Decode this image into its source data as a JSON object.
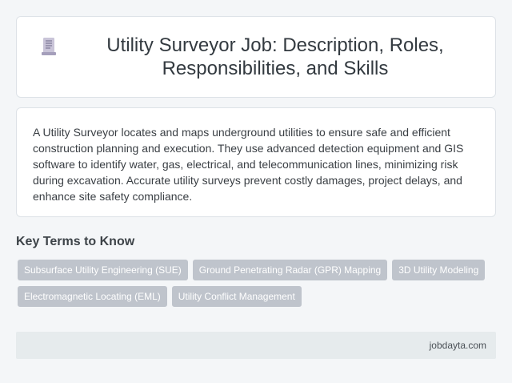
{
  "header": {
    "icon": "document-icon",
    "title": "Utility Surveyor Job: Description, Roles, Responsibilities, and Skills"
  },
  "description": "A Utility Surveyor locates and maps underground utilities to ensure safe and efficient construction planning and execution. They use advanced detection equipment and GIS software to identify water, gas, electrical, and telecommunication lines, minimizing risk during excavation. Accurate utility surveys prevent costly damages, project delays, and enhance site safety compliance.",
  "key_terms": {
    "heading": "Key Terms to Know",
    "tags": [
      "Subsurface Utility Engineering (SUE)",
      "Ground Penetrating Radar (GPR) Mapping",
      "3D Utility Modeling",
      "Electromagnetic Locating (EML)",
      "Utility Conflict Management"
    ]
  },
  "footer": {
    "site": "jobdayta.com"
  },
  "colors": {
    "tag_background": "#bfc4cc",
    "footer_background": "#e6ebed",
    "page_background": "#f4f6f8"
  }
}
